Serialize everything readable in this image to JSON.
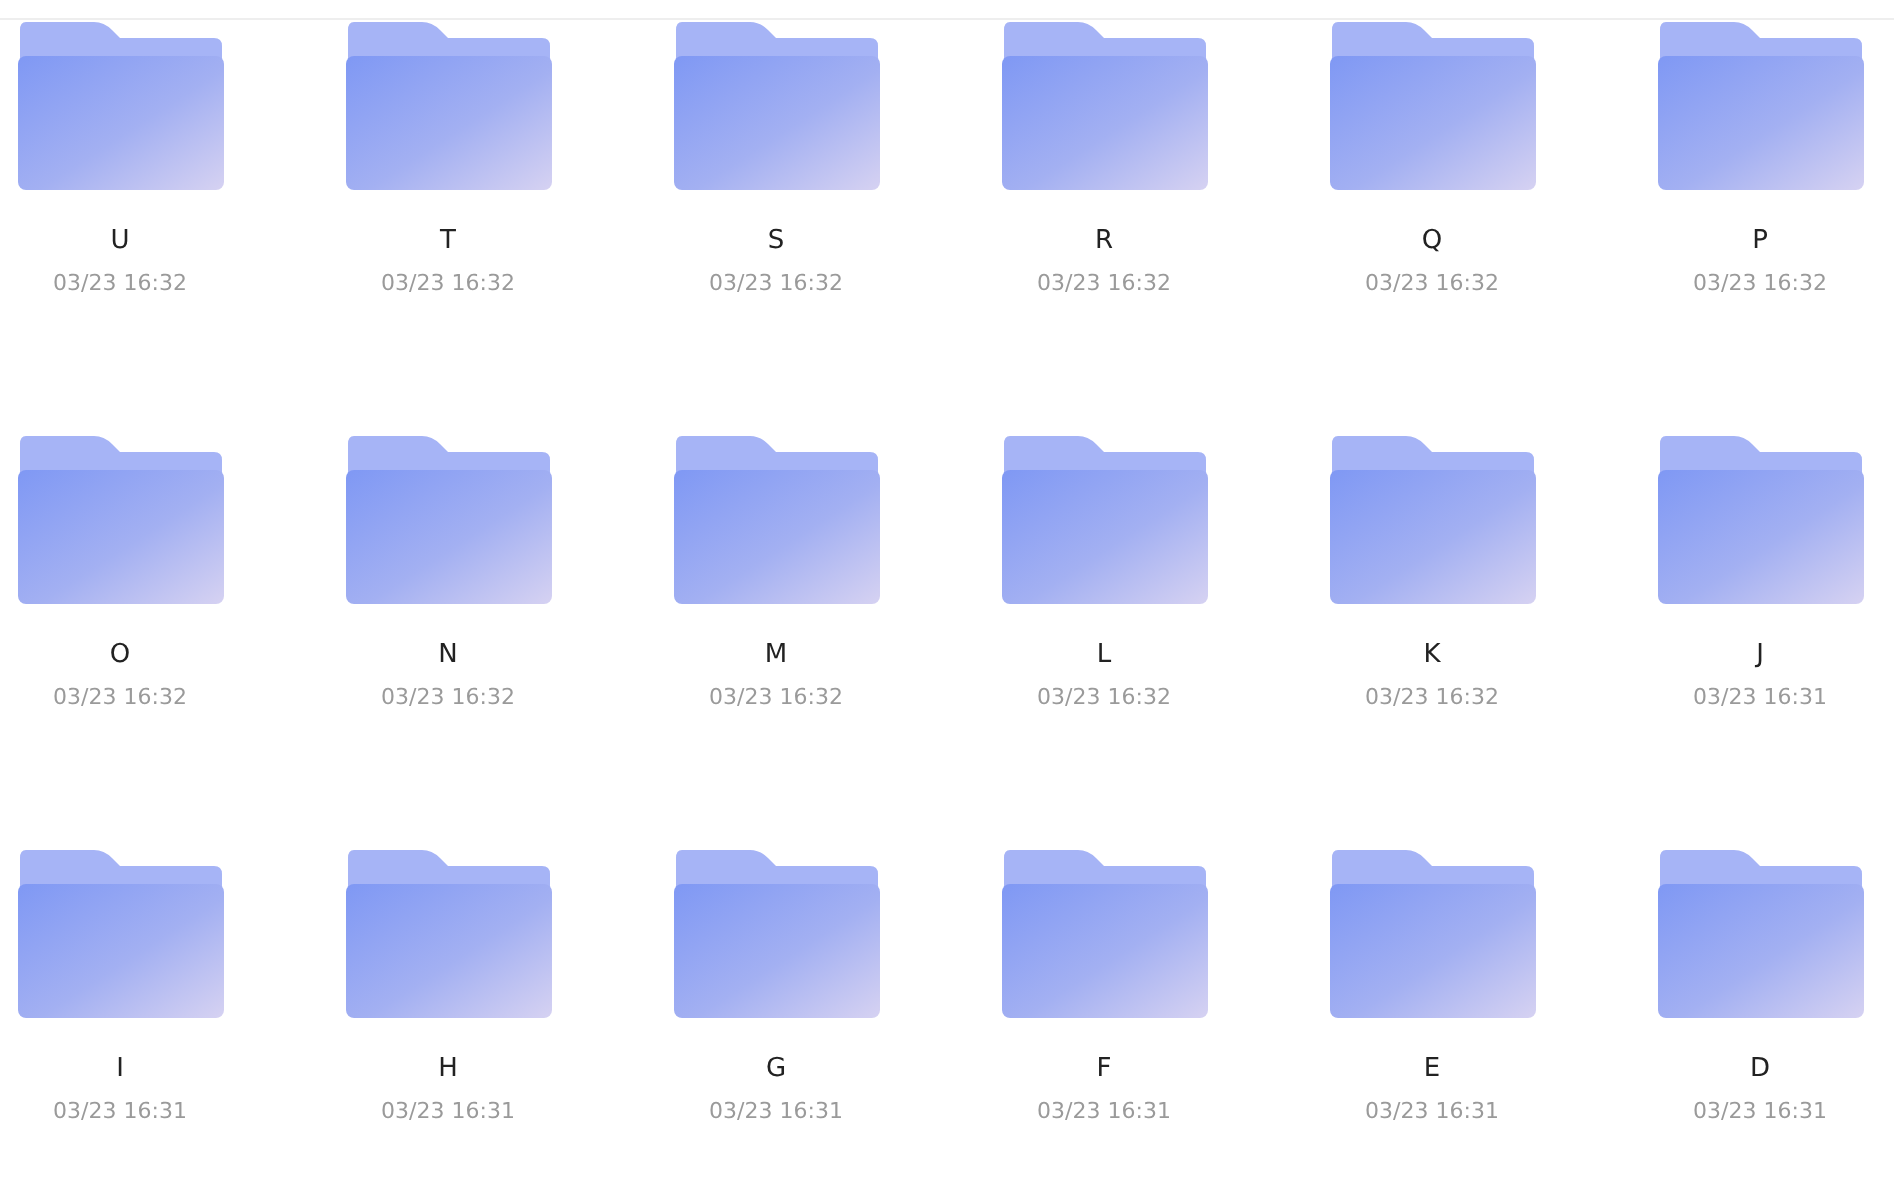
{
  "folders": [
    {
      "name": "U",
      "date": "03/23 16:32"
    },
    {
      "name": "T",
      "date": "03/23 16:32"
    },
    {
      "name": "S",
      "date": "03/23 16:32"
    },
    {
      "name": "R",
      "date": "03/23 16:32"
    },
    {
      "name": "Q",
      "date": "03/23 16:32"
    },
    {
      "name": "P",
      "date": "03/23 16:32"
    },
    {
      "name": "O",
      "date": "03/23 16:32"
    },
    {
      "name": "N",
      "date": "03/23 16:32"
    },
    {
      "name": "M",
      "date": "03/23 16:32"
    },
    {
      "name": "L",
      "date": "03/23 16:32"
    },
    {
      "name": "K",
      "date": "03/23 16:32"
    },
    {
      "name": "J",
      "date": "03/23 16:31"
    },
    {
      "name": "I",
      "date": "03/23 16:31"
    },
    {
      "name": "H",
      "date": "03/23 16:31"
    },
    {
      "name": "G",
      "date": "03/23 16:31"
    },
    {
      "name": "F",
      "date": "03/23 16:31"
    },
    {
      "name": "E",
      "date": "03/23 16:31"
    },
    {
      "name": "D",
      "date": "03/23 16:31"
    }
  ]
}
